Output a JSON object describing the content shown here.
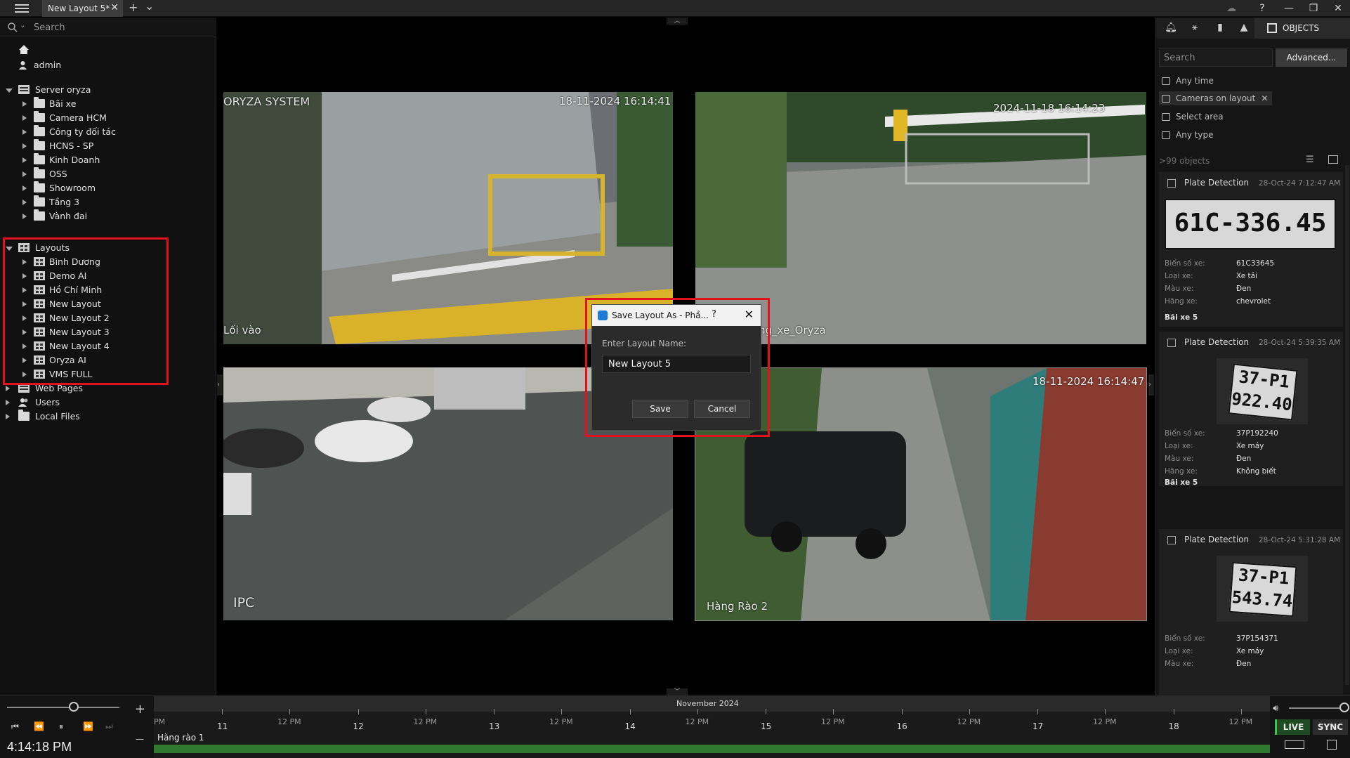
{
  "window": {
    "tab_title": "New Layout 5*",
    "add_tab": "+",
    "tab_list": "⌄",
    "help": "?",
    "minimize": "—",
    "restore": "❐",
    "close": "✕"
  },
  "left_panel": {
    "search_placeholder": "Search",
    "user": "admin",
    "server": {
      "label": "Server oryza",
      "children": [
        "Bãi xe",
        "Camera HCM",
        "Công ty đối tác",
        "HCNS - SP",
        "Kinh Doanh",
        "OSS",
        "Showroom",
        "Tầng 3",
        "Vành đai"
      ]
    },
    "layouts": {
      "label": "Layouts",
      "children": [
        "Bình Dương",
        "Demo AI",
        "Hồ Chí Minh",
        "New Layout",
        "New Layout 2",
        "New Layout 3",
        "New Layout 4",
        "Oryza AI",
        "VMS FULL"
      ]
    },
    "web_pages": "Web Pages",
    "users": "Users",
    "local_files": "Local Files"
  },
  "cameras": [
    {
      "label": "Lối vào",
      "timestamp": "18-11-2024 16:14:41",
      "overlay": "ORYZA SYSTEM"
    },
    {
      "label": "ng_xe_Oryza",
      "timestamp": "2024-11-18 16:14:23"
    },
    {
      "label": "IPC",
      "timestamp": ""
    },
    {
      "label": "Hàng Rào 2",
      "timestamp": "18-11-2024 16:14:47"
    }
  ],
  "dialog": {
    "title": "Save Layout As - Phầ...",
    "help": "?",
    "close": "✕",
    "label": "Enter Layout Name:",
    "value": "New Layout 5",
    "save": "Save",
    "cancel": "Cancel"
  },
  "right_panel": {
    "objects_tab": "OBJECTS",
    "search_placeholder": "Search",
    "advanced": "Advanced...",
    "filters": {
      "time": "Any time",
      "cameras": "Cameras on layout",
      "area": "Select area",
      "type": "Any type"
    },
    "count": ">99 objects",
    "cards": [
      {
        "title": "Plate Detection",
        "date": "28-Oct-24 7:12:47 AM",
        "plate_text": "61C-336.45",
        "fields": [
          {
            "k": "Biển số xe:",
            "v": "61C33645"
          },
          {
            "k": "Loại xe:",
            "v": "Xe tải"
          },
          {
            "k": "Màu xe:",
            "v": "Đen"
          },
          {
            "k": "Hãng xe:",
            "v": "chevrolet"
          }
        ],
        "location": "Bãi xe 5"
      },
      {
        "title": "Plate Detection",
        "date": "28-Oct-24 5:39:35 AM",
        "plate_line1": "37-P1",
        "plate_line2": "922.40",
        "fields": [
          {
            "k": "Biển số xe:",
            "v": "37P192240"
          },
          {
            "k": "Loại xe:",
            "v": "Xe máy"
          },
          {
            "k": "Màu xe:",
            "v": "Đen"
          },
          {
            "k": "Hãng xe:",
            "v": "Không biết"
          }
        ],
        "location": "Bãi xe 5"
      },
      {
        "title": "Plate Detection",
        "date": "28-Oct-24 5:31:28 AM",
        "plate_line1": "37-P1",
        "plate_line2": "543.74",
        "fields": [
          {
            "k": "Biển số xe:",
            "v": "37P154371"
          },
          {
            "k": "Loại xe:",
            "v": "Xe máy"
          },
          {
            "k": "Màu xe:",
            "v": "Đen"
          }
        ]
      }
    ]
  },
  "timeline": {
    "month": "November 2024",
    "days": [
      "11",
      "12",
      "13",
      "14",
      "15",
      "16",
      "17",
      "18"
    ],
    "noon_label": "12 PM",
    "pm_label": "PM",
    "track": "Hàng rào 1",
    "clock": "4:14:18 PM",
    "zoom_in": "+",
    "zoom_out": "—",
    "live": "LIVE",
    "sync": "SYNC"
  }
}
